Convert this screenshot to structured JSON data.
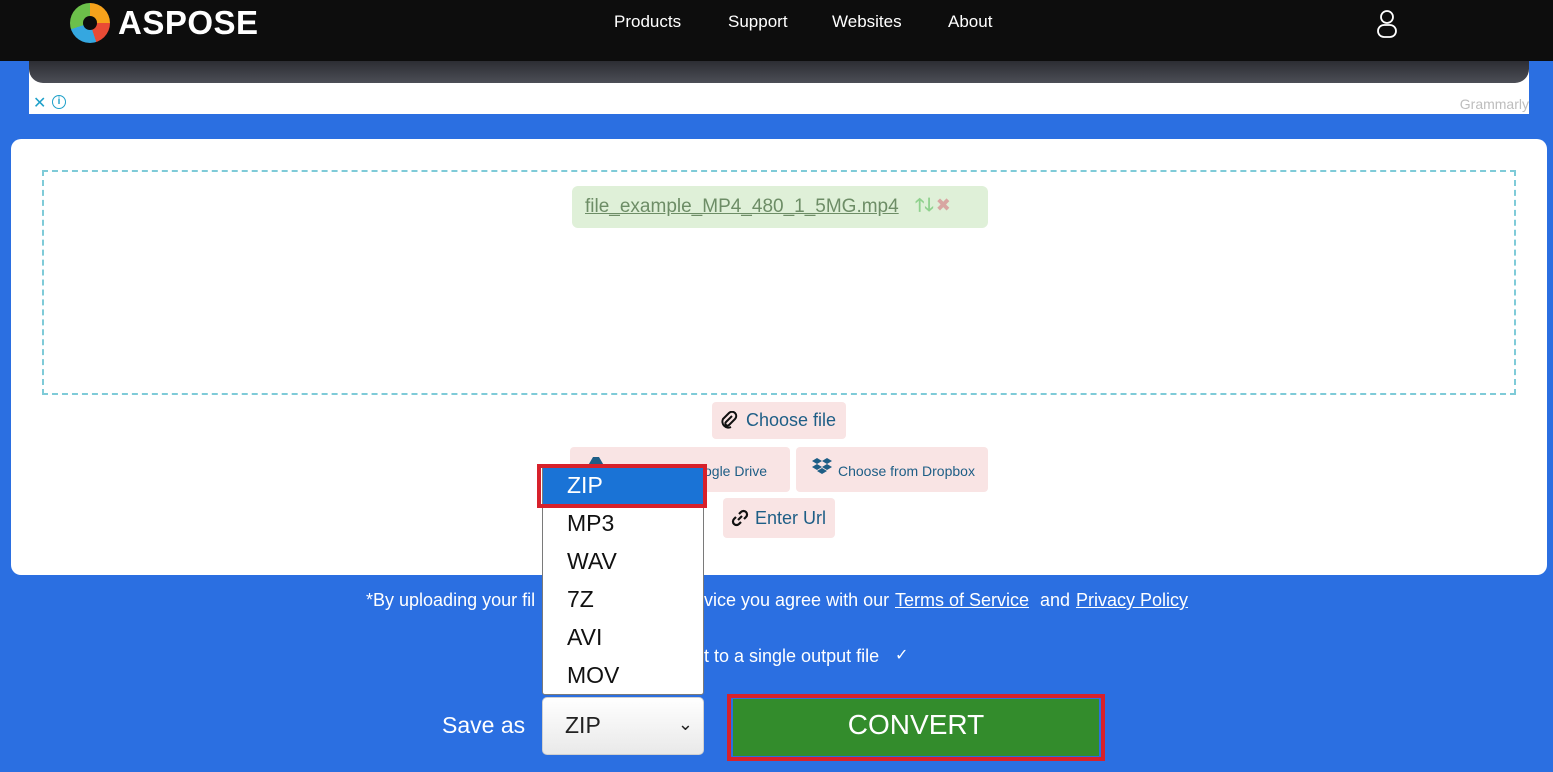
{
  "header": {
    "brand": "ASPOSE",
    "nav": [
      {
        "label": "Products"
      },
      {
        "label": "Support"
      },
      {
        "label": "Websites"
      },
      {
        "label": "About"
      }
    ]
  },
  "ad": {
    "close_symbol": "✕",
    "info_symbol": "i",
    "brand": "Grammarly"
  },
  "upload": {
    "file_name": "file_example_MP4_480_1_5MG.mp4",
    "up_symbol": "🡑",
    "down_symbol": "🡓",
    "remove_symbol": "✖",
    "choose_file": "Choose file",
    "google_drive_visible": "ogle Drive",
    "dropbox": "Choose from Dropbox",
    "enter_url": "Enter Url"
  },
  "format_dropdown": {
    "options": [
      "ZIP",
      "MP3",
      "WAV",
      "7Z",
      "AVI",
      "MOV"
    ],
    "selected_index": 0
  },
  "terms": {
    "prefix": "*By uploading your fil",
    "middle": "vice you agree with our",
    "terms_link": "Terms of Service",
    "and": "and",
    "privacy_link": "Privacy Policy"
  },
  "options": {
    "single_output_visible": "t to a single output file",
    "single_output_checked": true,
    "check_symbol": "✓"
  },
  "save": {
    "label": "Save as",
    "selected": "ZIP",
    "chevron": "⌄"
  },
  "convert": {
    "label": "CONVERT"
  },
  "colors": {
    "page_bg": "#2b6fe1",
    "header_bg": "#0d0d0d",
    "convert_bg": "#338c2c",
    "highlight_red": "#d7212b",
    "selected_option": "#1a73d6"
  }
}
